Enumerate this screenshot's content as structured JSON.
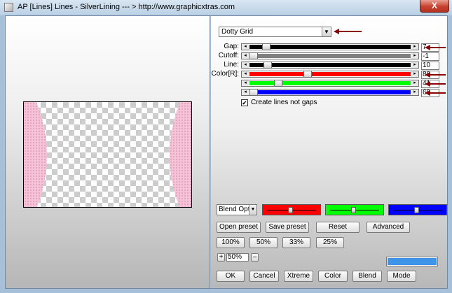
{
  "window": {
    "title": "AP [Lines]  Lines - SilverLining    --- > http://www.graphicxtras.com",
    "close_label": "X"
  },
  "preset": {
    "value": "Dotty Grid"
  },
  "sliders": [
    {
      "label": "Gap:",
      "value": "7",
      "color": "#000000",
      "fill": 0.08
    },
    {
      "label": "Cutoff:",
      "value": "-1",
      "color": "#808080",
      "fill": 0.0
    },
    {
      "label": "Line:",
      "value": "10",
      "color": "#000000",
      "fill": 0.09
    },
    {
      "label": "Color[R]:",
      "value": "88",
      "color": "#ff0000",
      "fill": 0.35
    },
    {
      "label": "",
      "value": "41",
      "color": "#00ff00",
      "fill": 0.16
    },
    {
      "label": "",
      "value": "69",
      "color": "#0000ff",
      "fill": 0.0
    }
  ],
  "create_lines": {
    "label": "Create lines not gaps",
    "checked": true,
    "check_mark": "✔"
  },
  "blend": {
    "value": "Blend Optio"
  },
  "color_sliders": [
    {
      "color": "#ff0000",
      "level": 0.5
    },
    {
      "color": "#00ff00",
      "level": 0.5
    },
    {
      "color": "#0000ff",
      "level": 0.5
    }
  ],
  "buttons": {
    "open_preset": "Open preset",
    "save_preset": "Save preset",
    "reset": "Reset",
    "advanced": "Advanced",
    "z100": "100%",
    "z50": "50%",
    "z33": "33%",
    "z25": "25%",
    "plus": "+",
    "minus": "–",
    "zoom_value": "50%",
    "ok": "OK",
    "cancel": "Cancel",
    "xtreme": "Xtreme",
    "color": "Color",
    "blend": "Blend",
    "mode": "Mode"
  },
  "colors": {
    "swatch": "#3d94e8",
    "annotation_arrow": "#8b0000",
    "preview_pink": "#f7c2d8"
  }
}
